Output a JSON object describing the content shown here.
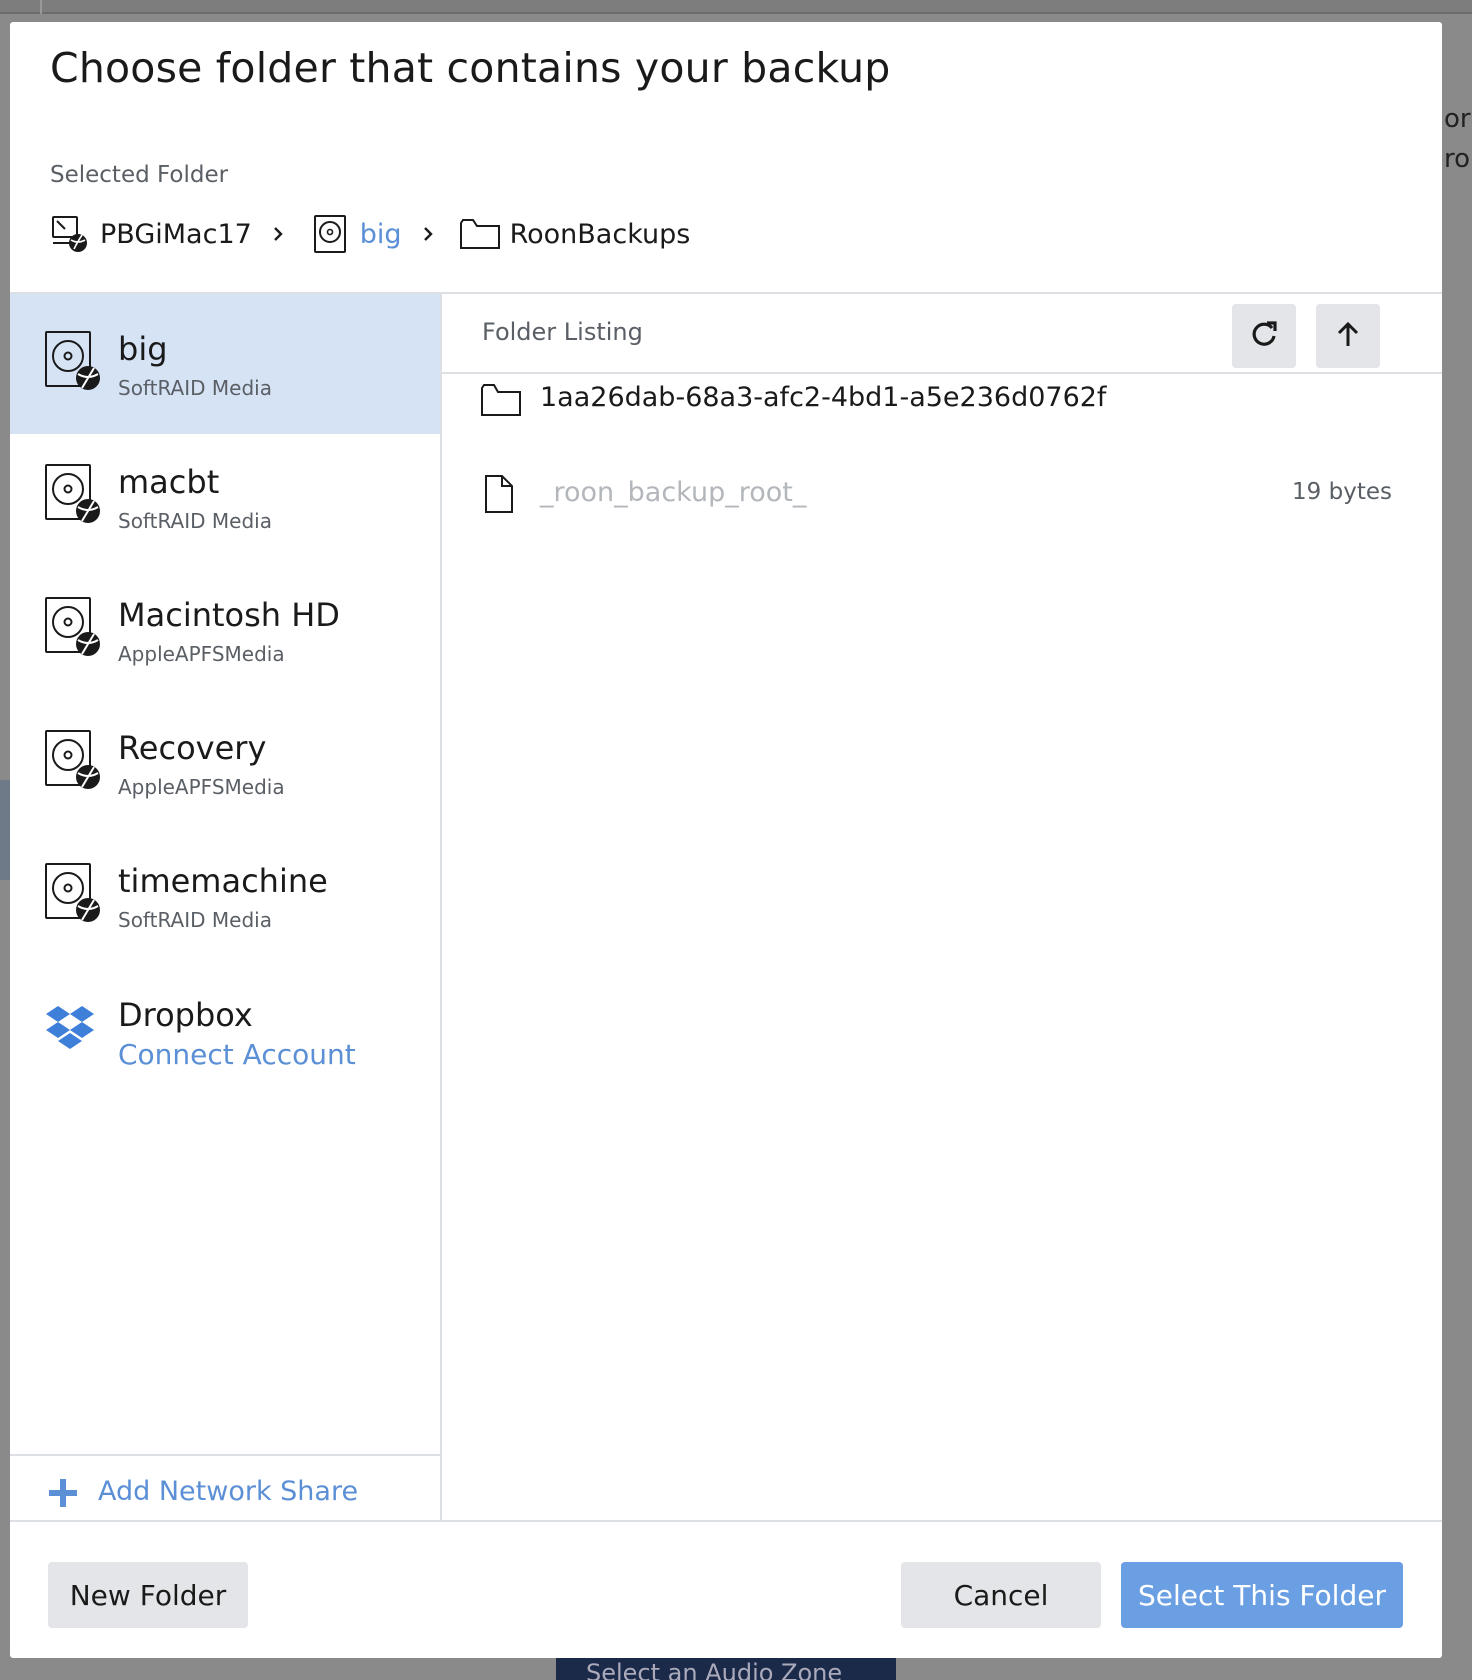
{
  "background": {
    "right_fragments": [
      "or",
      "ro"
    ],
    "bottom_fragment": "Select an Audio Zone"
  },
  "dialog": {
    "title": "Choose folder that contains your backup",
    "selected_folder_label": "Selected Folder",
    "breadcrumb": [
      {
        "label": "PBGiMac17",
        "icon": "computer-icon",
        "link": false
      },
      {
        "label": "big",
        "icon": "drive-icon",
        "link": true
      },
      {
        "label": "RoonBackups",
        "icon": "folder-icon",
        "link": false
      }
    ]
  },
  "sidebar": {
    "volumes": [
      {
        "name": "big",
        "subtitle": "SoftRAID Media",
        "icon": "drive-icon",
        "selected": true
      },
      {
        "name": "macbt",
        "subtitle": "SoftRAID Media",
        "icon": "drive-icon",
        "selected": false
      },
      {
        "name": "Macintosh HD",
        "subtitle": "AppleAPFSMedia",
        "icon": "drive-icon",
        "selected": false
      },
      {
        "name": "Recovery",
        "subtitle": "AppleAPFSMedia",
        "icon": "drive-icon",
        "selected": false
      },
      {
        "name": "timemachine",
        "subtitle": "SoftRAID Media",
        "icon": "drive-icon",
        "selected": false
      },
      {
        "name": "Dropbox",
        "subtitle": "Connect Account",
        "icon": "dropbox-icon",
        "selected": false
      }
    ],
    "add_network_share": "Add Network Share"
  },
  "listing": {
    "header": "Folder Listing",
    "entries": [
      {
        "name": "1aa26dab-68a3-afc2-4bd1-a5e236d0762f",
        "type": "folder",
        "size": ""
      },
      {
        "name": "_roon_backup_root_",
        "type": "file",
        "size": "19 bytes"
      }
    ]
  },
  "footer": {
    "new_folder": "New Folder",
    "cancel": "Cancel",
    "select": "Select This Folder"
  },
  "colors": {
    "accent": "#5b8fd6",
    "primary_button": "#6b9fe3",
    "selected_row": "#d6e3f5",
    "secondary_button": "#e3e5e8"
  }
}
